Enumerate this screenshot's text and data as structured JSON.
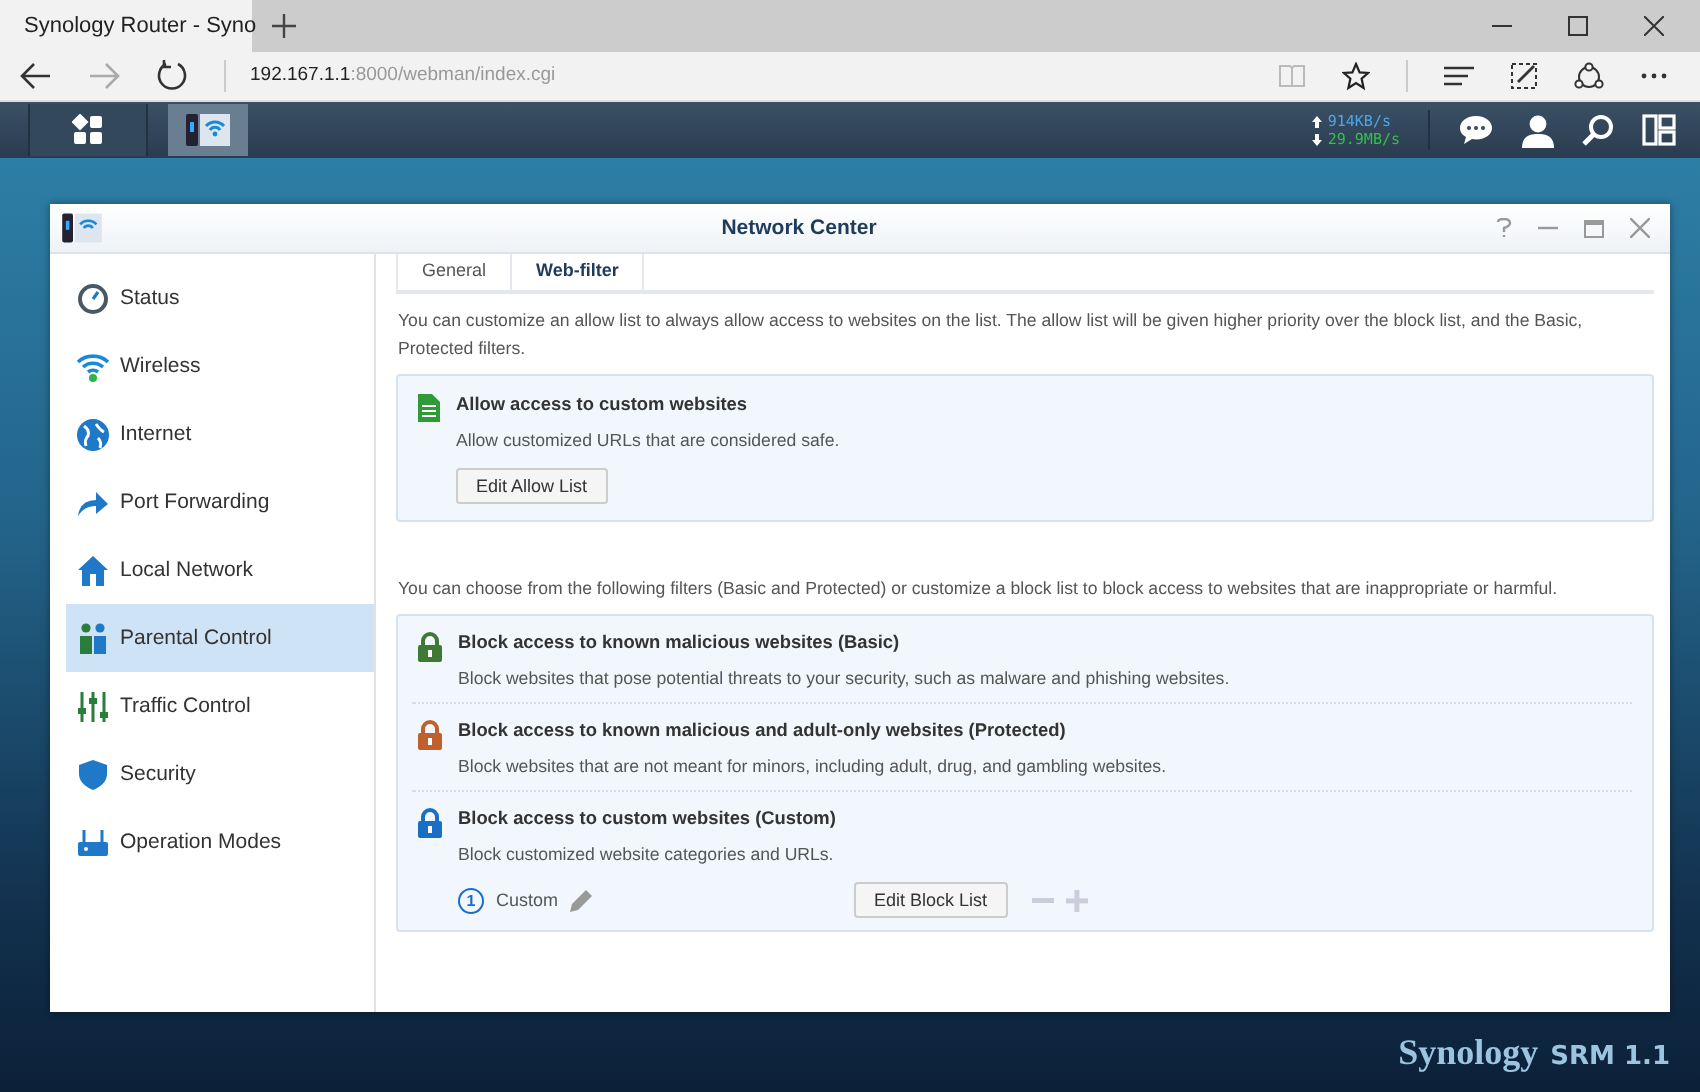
{
  "browser": {
    "tab_title": "Synology Router - Syno",
    "address": {
      "host": "192.167.1.1",
      "path": ":8000/webman/index.cgi"
    }
  },
  "taskbar": {
    "upload": "914KB/s",
    "download": "29.9MB/s"
  },
  "window": {
    "title": "Network Center"
  },
  "sidebar": {
    "items": [
      {
        "label": "Status",
        "selected": false
      },
      {
        "label": "Wireless",
        "selected": false
      },
      {
        "label": "Internet",
        "selected": false
      },
      {
        "label": "Port Forwarding",
        "selected": false
      },
      {
        "label": "Local Network",
        "selected": false
      },
      {
        "label": "Parental Control",
        "selected": true
      },
      {
        "label": "Traffic Control",
        "selected": false
      },
      {
        "label": "Security",
        "selected": false
      },
      {
        "label": "Operation Modes",
        "selected": false
      }
    ]
  },
  "tabs": [
    {
      "label": "General",
      "selected": false
    },
    {
      "label": "Web-filter",
      "selected": true
    }
  ],
  "allow_intro": "You can customize an allow list to always allow access to websites on the list. The allow list will be given higher priority over the block list, and the Basic, Protected filters.",
  "allow_section": {
    "title": "Allow access to custom websites",
    "description": "Allow customized URLs that are considered safe.",
    "button": "Edit Allow List"
  },
  "block_intro": "You can choose from the following filters (Basic and Protected) or customize a block list to block access to websites that are inappropriate or harmful.",
  "filters": [
    {
      "title": "Block access to known malicious websites (Basic)",
      "description": "Block websites that pose potential threats to your security, such as malware and phishing websites.",
      "color": "#3f7a35"
    },
    {
      "title": "Block access to known malicious and adult-only websites (Protected)",
      "description": "Block websites that are not meant for minors, including adult, drug, and gambling websites.",
      "color": "#c0602f"
    },
    {
      "title": "Block access to custom websites (Custom)",
      "description": "Block customized website categories and URLs.",
      "color": "#1a6fc4"
    }
  ],
  "custom_list": {
    "number": "1",
    "label": "Custom",
    "button": "Edit Block List"
  },
  "branding": {
    "brand": "Synology",
    "product": "SRM 1.1"
  }
}
